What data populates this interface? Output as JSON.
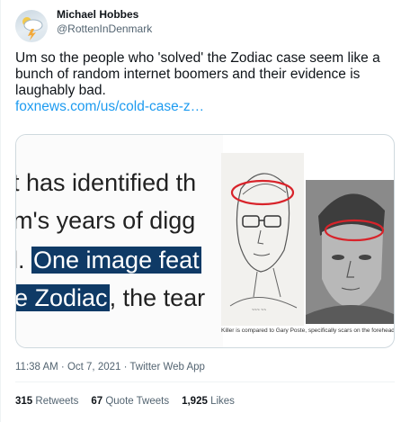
{
  "author": {
    "display_name": "Michael Hobbes",
    "handle": "@RottenInDenmark",
    "avatar_icon": "weather-storm-icon"
  },
  "tweet": {
    "text": "Um so the people who 'solved' the Zodiac case seem like a bunch of random internet boomers and their evidence is laughably bad.",
    "link": "foxnews.com/us/cold-case-z…"
  },
  "media": {
    "article_lines": [
      "t has identified th",
      "m's years of digg"
    ],
    "line3_prefix": "l. ",
    "line3_highlight": "One image feat",
    "line4_highlight": "e Zodiac",
    "line4_rest": ", the tear",
    "caption": "Killer is compared to Gary Poste, specifically scars on the forehead in both",
    "highlight_color": "#0f3a66",
    "circle_color": "#d8232a"
  },
  "meta": {
    "timestamp": "11:38 AM · Oct 7, 2021 · Twitter Web App"
  },
  "stats": {
    "retweets_count": "315",
    "retweets_label": "Retweets",
    "quotes_count": "67",
    "quotes_label": "Quote Tweets",
    "likes_count": "1,925",
    "likes_label": "Likes"
  }
}
